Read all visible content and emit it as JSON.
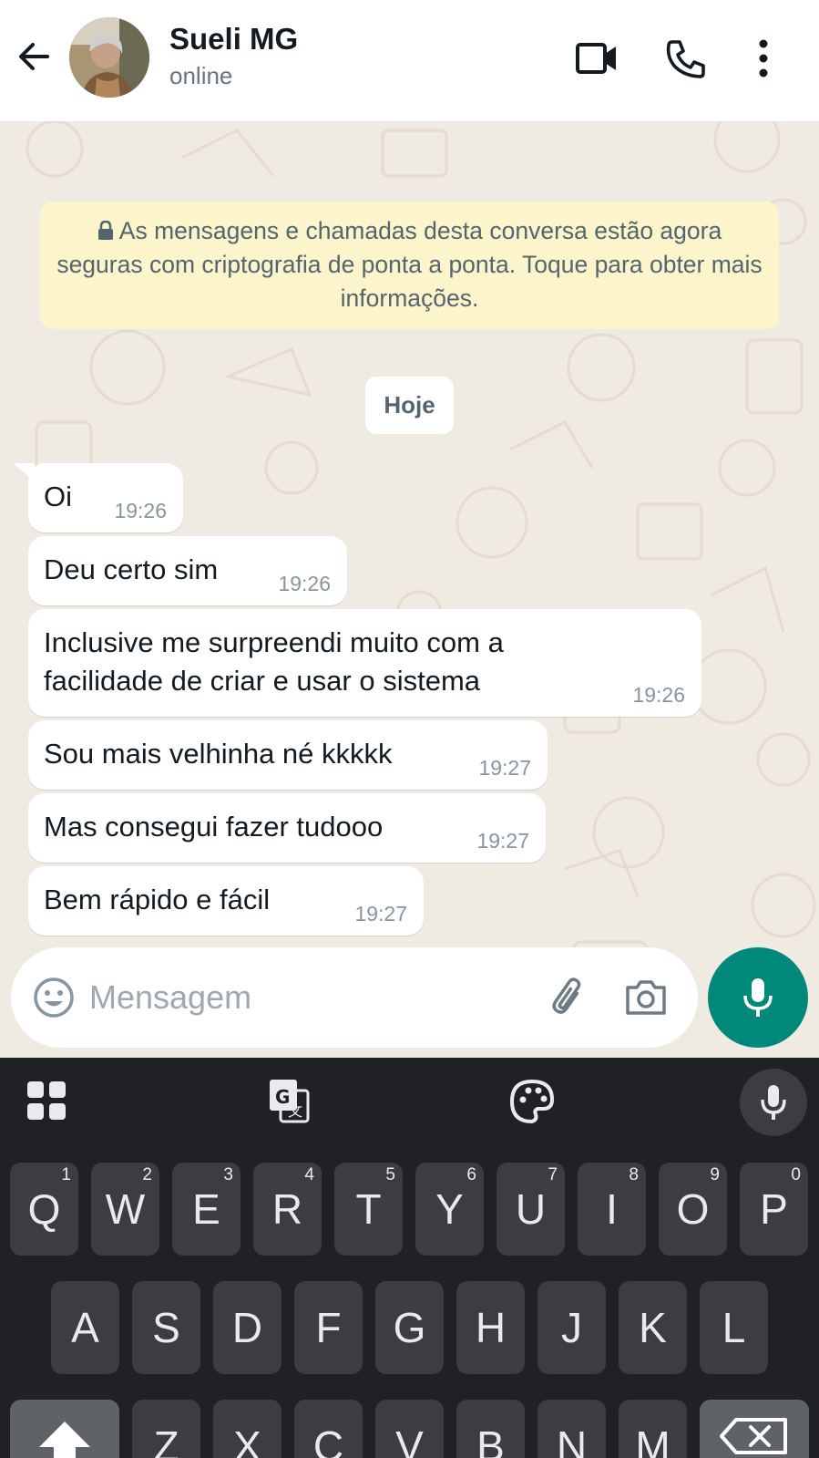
{
  "header": {
    "name": "Sueli MG",
    "status": "online",
    "icons": [
      "back-arrow-icon",
      "video-call-icon",
      "voice-call-icon",
      "more-options-icon"
    ]
  },
  "chat": {
    "encryption_notice": "As mensagens e chamadas desta conversa estão agora seguras com criptografia de ponta a ponta. Toque para obter mais informações.",
    "date_label": "Hoje",
    "messages": [
      {
        "lines": [
          "Oi"
        ],
        "time": "19:26"
      },
      {
        "lines": [
          "Deu certo sim"
        ],
        "time": "19:26"
      },
      {
        "lines": [
          "Inclusive me surpreendi muito com a",
          "facilidade de criar e usar o sistema"
        ],
        "time": "19:26"
      },
      {
        "lines": [
          "Sou mais velhinha né kkkkk"
        ],
        "time": "19:27"
      },
      {
        "lines": [
          "Mas consegui fazer tudooo"
        ],
        "time": "19:27"
      },
      {
        "lines": [
          "Bem rápido e fácil"
        ],
        "time": "19:27"
      }
    ]
  },
  "composer": {
    "placeholder": "Mensagem"
  },
  "keyboard": {
    "row1": [
      {
        "key": "Q",
        "num": "1"
      },
      {
        "key": "W",
        "num": "2"
      },
      {
        "key": "E",
        "num": "3"
      },
      {
        "key": "R",
        "num": "4"
      },
      {
        "key": "T",
        "num": "5"
      },
      {
        "key": "Y",
        "num": "6"
      },
      {
        "key": "U",
        "num": "7"
      },
      {
        "key": "I",
        "num": "8"
      },
      {
        "key": "O",
        "num": "9"
      },
      {
        "key": "P",
        "num": "0"
      }
    ],
    "row2": [
      "A",
      "S",
      "D",
      "F",
      "G",
      "H",
      "J",
      "K",
      "L"
    ],
    "row3": [
      "Z",
      "X",
      "C",
      "V",
      "B",
      "N",
      "M"
    ]
  },
  "colors": {
    "accent": "#00897b",
    "notice_bg": "#fcf4cb",
    "chat_bg": "#efeae2",
    "keyboard_bg": "#202124",
    "key_bg": "#3c3d41"
  }
}
